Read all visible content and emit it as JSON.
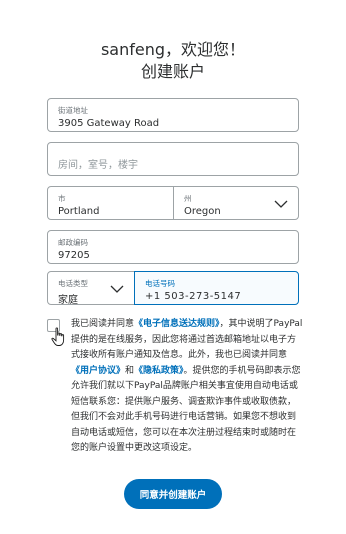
{
  "header": {
    "greeting": "sanfeng，欢迎您！",
    "title": "创建账户"
  },
  "form": {
    "address": {
      "label": "街道地址",
      "value": "3905 Gateway Road"
    },
    "apt": {
      "placeholder": "房间，室号，楼宇"
    },
    "city": {
      "label": "市",
      "value": "Portland"
    },
    "state": {
      "label": "州",
      "value": "Oregon"
    },
    "zip": {
      "label": "邮政编码",
      "value": "97205"
    },
    "phone_type": {
      "label": "电话类型",
      "value": "家庭"
    },
    "phone": {
      "label": "电话号码",
      "value": "+1  503-273-5147"
    }
  },
  "consent": {
    "checked": false,
    "text_1": "我已阅读并同意",
    "link_esign": "《电子信息送达规则》",
    "text_2": "，其中说明了PayPal提供的是在线服务，因此您将通过首选邮箱地址以电子方式接收所有账户通知及信息。此外，我也已阅读并同意",
    "link_user": "《用户协议》",
    "text_3": "和",
    "link_privacy": "《隐私政策》",
    "text_4": "。提供您的手机号码即表示您允许我们就以下PayPal品牌账户相关事宜使用自动电话或短信联系您：提供账户服务、调查欺诈事件或收取债款，但我们不会对此手机号码进行电话营销。如果您不想收到自动电话或短信，您可以在本次注册过程结束时或随时在您的账户设置中更改这项设定。"
  },
  "actions": {
    "submit_label": "同意并创建账户"
  },
  "icons": {
    "dropdown": "chevron-down-icon",
    "cursor": "hand-pointer-icon"
  },
  "colors": {
    "accent": "#0070ba",
    "text": "#2c2e2f",
    "border": "#9da3a6"
  }
}
